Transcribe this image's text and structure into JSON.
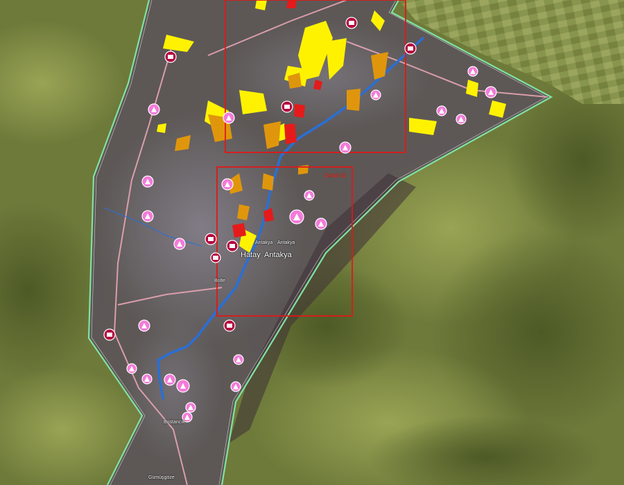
{
  "map": {
    "labels": {
      "city": "Hatay",
      "district": "Antakya",
      "city_sub": "Antakya",
      "neighbourhood_a": "Antakya",
      "bolu": "Bolte",
      "bostancik": "Bostancık",
      "gumusgoze": "Gümüşgöze",
      "detail_02": "Detail 02"
    },
    "colors": {
      "terrain": "#6e7a3a",
      "urban": "#5b5559",
      "aoi_outline": "#7fe3a0",
      "river": "#2a6fd6",
      "road": "#e8a6b4",
      "damage_destroyed": "#e51b1b",
      "damage_severe": "#e0960c",
      "damage_moderate": "#fff200",
      "detail_frame": "#e01818",
      "marker_pink": "#f37bd9",
      "marker_dark": "#b3003c"
    },
    "icons": {
      "pink_marker": "emergency-site-icon",
      "dark_marker": "critical-facility-icon"
    }
  }
}
